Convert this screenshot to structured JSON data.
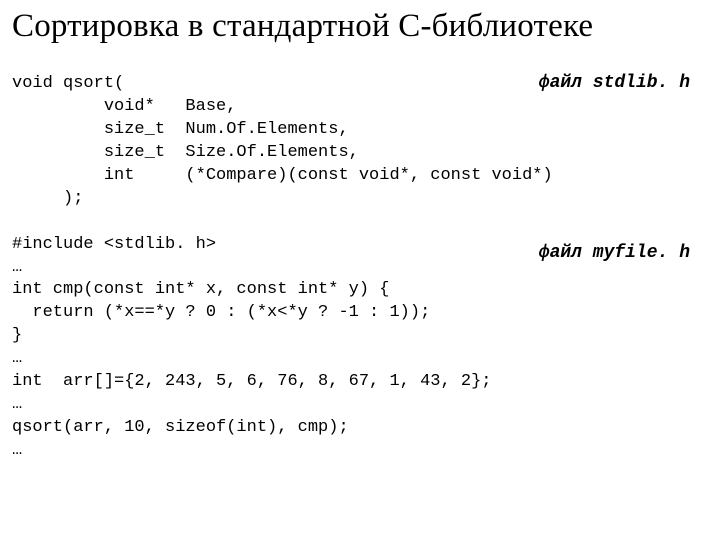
{
  "title": "Сортировка в стандартной С-библиотеке",
  "annotation1": "файл stdlib. h",
  "annotation2": "файл myfile. h",
  "code": {
    "l01": "void qsort(",
    "l02": "         void*   Base,",
    "l03": "         size_t  Num.Of.Elements,",
    "l04": "         size_t  Size.Of.Elements,",
    "l05": "         int     (*Compare)(const void*, const void*)",
    "l06": "     );",
    "l07": "",
    "l08": "#include <stdlib. h>",
    "l09": "…",
    "l10": "int cmp(const int* x, const int* y) {",
    "l11": "  return (*x==*y ? 0 : (*x<*y ? -1 : 1));",
    "l12": "}",
    "l13": "…",
    "l14": "int  arr[]={2, 243, 5, 6, 76, 8, 67, 1, 43, 2};",
    "l15": "…",
    "l16": "qsort(arr, 10, sizeof(int), cmp);",
    "l17": "…"
  }
}
